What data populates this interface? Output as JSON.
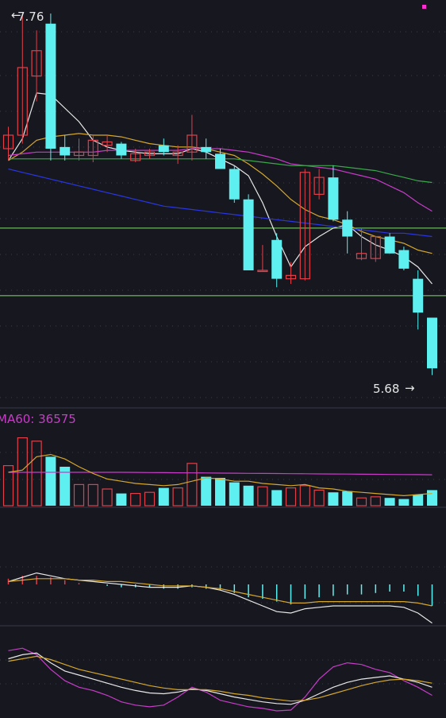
{
  "colors": {
    "background": "#16171f",
    "up": "#e0404a",
    "down": "#5ef0f0",
    "grid": "#3a3d4a",
    "ma_white": "#e8e8e8",
    "ma_yellow": "#d4a72c",
    "ma_magenta": "#c83cc8",
    "ma_green": "#3aa84a",
    "trend_blue": "#2a36e0",
    "hline": "#7fe06a",
    "marker": "#ff2fd0"
  },
  "chart_data": [
    {
      "type": "candlestick",
      "price_range": [
        5.5,
        7.9
      ],
      "high_label": "7.76",
      "low_label": "5.68",
      "high_arrow": "←",
      "low_arrow": "→",
      "candles": [
        {
          "o": 7.02,
          "h": 7.15,
          "l": 6.95,
          "c": 7.1
        },
        {
          "o": 7.1,
          "h": 7.82,
          "l": 7.05,
          "c": 7.5
        },
        {
          "o": 7.45,
          "h": 7.72,
          "l": 7.3,
          "c": 7.6
        },
        {
          "o": 7.76,
          "h": 7.82,
          "l": 6.95,
          "c": 7.02
        },
        {
          "o": 7.03,
          "h": 7.1,
          "l": 6.95,
          "c": 6.98
        },
        {
          "o": 6.98,
          "h": 7.08,
          "l": 6.95,
          "c": 7.0
        },
        {
          "o": 6.98,
          "h": 7.1,
          "l": 6.94,
          "c": 7.07
        },
        {
          "o": 7.04,
          "h": 7.1,
          "l": 7.0,
          "c": 7.06
        },
        {
          "o": 7.05,
          "h": 7.06,
          "l": 6.96,
          "c": 6.98
        },
        {
          "o": 6.95,
          "h": 7.02,
          "l": 6.94,
          "c": 6.99
        },
        {
          "o": 6.98,
          "h": 7.02,
          "l": 6.96,
          "c": 7.0
        },
        {
          "o": 7.04,
          "h": 7.08,
          "l": 6.98,
          "c": 7.0
        },
        {
          "o": 6.98,
          "h": 7.04,
          "l": 6.93,
          "c": 7.0
        },
        {
          "o": 7.0,
          "h": 7.22,
          "l": 6.95,
          "c": 7.1
        },
        {
          "o": 7.03,
          "h": 7.08,
          "l": 6.96,
          "c": 7.0
        },
        {
          "o": 6.99,
          "h": 7.02,
          "l": 6.9,
          "c": 6.9
        },
        {
          "o": 6.9,
          "h": 6.92,
          "l": 6.7,
          "c": 6.72
        },
        {
          "o": 6.72,
          "h": 6.75,
          "l": 6.3,
          "c": 6.3
        },
        {
          "o": 6.3,
          "h": 6.45,
          "l": 6.3,
          "c": 6.3
        },
        {
          "o": 6.48,
          "h": 6.52,
          "l": 6.2,
          "c": 6.25
        },
        {
          "o": 6.25,
          "h": 6.35,
          "l": 6.22,
          "c": 6.27
        },
        {
          "o": 6.25,
          "h": 6.9,
          "l": 6.24,
          "c": 6.88
        },
        {
          "o": 6.75,
          "h": 6.9,
          "l": 6.72,
          "c": 6.85
        },
        {
          "o": 6.85,
          "h": 6.92,
          "l": 6.59,
          "c": 6.6
        },
        {
          "o": 6.6,
          "h": 6.65,
          "l": 6.4,
          "c": 6.5
        },
        {
          "o": 6.37,
          "h": 6.55,
          "l": 6.36,
          "c": 6.4
        },
        {
          "o": 6.37,
          "h": 6.5,
          "l": 6.35,
          "c": 6.5
        },
        {
          "o": 6.5,
          "h": 6.52,
          "l": 6.4,
          "c": 6.4
        },
        {
          "o": 6.42,
          "h": 6.44,
          "l": 6.3,
          "c": 6.31
        },
        {
          "o": 6.25,
          "h": 6.3,
          "l": 5.95,
          "c": 6.05
        },
        {
          "o": 6.02,
          "h": 6.02,
          "l": 5.68,
          "c": 5.72
        }
      ],
      "overlay_lines": [
        {
          "color_key": "ma_white",
          "values": [
            6.95,
            7.08,
            7.35,
            7.34,
            7.26,
            7.18,
            7.07,
            7.03,
            7.01,
            7.0,
            6.99,
            6.99,
            6.99,
            7.02,
            7.0,
            6.96,
            6.92,
            6.86,
            6.7,
            6.5,
            6.32,
            6.44,
            6.5,
            6.55,
            6.57,
            6.5,
            6.45,
            6.42,
            6.38,
            6.32,
            6.22
          ]
        },
        {
          "color_key": "ma_yellow",
          "values": [
            6.95,
            7.0,
            7.07,
            7.09,
            7.1,
            7.11,
            7.1,
            7.1,
            7.09,
            7.07,
            7.05,
            7.04,
            7.03,
            7.03,
            7.02,
            7.0,
            6.98,
            6.93,
            6.87,
            6.8,
            6.72,
            6.66,
            6.62,
            6.6,
            6.57,
            6.53,
            6.5,
            6.48,
            6.46,
            6.42,
            6.4
          ]
        },
        {
          "color_key": "ma_magenta",
          "values": [
            6.98,
            6.99,
            7.0,
            7.0,
            7.0,
            7.0,
            7.0,
            7.01,
            7.01,
            7.01,
            7.01,
            7.01,
            7.01,
            7.02,
            7.02,
            7.02,
            7.01,
            7.0,
            6.98,
            6.96,
            6.93,
            6.92,
            6.91,
            6.9,
            6.88,
            6.86,
            6.84,
            6.8,
            6.76,
            6.7,
            6.65
          ]
        },
        {
          "color_key": "ma_green",
          "values": [
            6.96,
            6.96,
            6.96,
            6.96,
            6.96,
            6.96,
            6.96,
            6.96,
            6.96,
            6.96,
            6.96,
            6.96,
            6.96,
            6.96,
            6.96,
            6.96,
            6.96,
            6.95,
            6.94,
            6.93,
            6.92,
            6.92,
            6.92,
            6.92,
            6.91,
            6.9,
            6.89,
            6.87,
            6.85,
            6.83,
            6.82
          ]
        },
        {
          "color_key": "trend_blue",
          "values": [
            6.9,
            6.88,
            6.86,
            6.84,
            6.82,
            6.8,
            6.78,
            6.76,
            6.74,
            6.72,
            6.7,
            6.68,
            6.67,
            6.66,
            6.65,
            6.64,
            6.63,
            6.62,
            6.61,
            6.6,
            6.59,
            6.58,
            6.57,
            6.56,
            6.55,
            6.54,
            6.53,
            6.52,
            6.52,
            6.51,
            6.5
          ]
        }
      ],
      "horizontal_lines": [
        6.55,
        6.15
      ]
    },
    {
      "type": "bar",
      "indicator_label": "MA60: 36575",
      "volumes": [
        36000,
        61000,
        58000,
        44000,
        35000,
        19000,
        19000,
        15000,
        11000,
        11000,
        12000,
        16000,
        16000,
        38000,
        26000,
        25000,
        21000,
        18000,
        17000,
        14000,
        16000,
        18000,
        14000,
        12000,
        13000,
        7000,
        8000,
        7000,
        6000,
        10000,
        14000
      ],
      "ma60_value": 36575,
      "ma_lines": [
        {
          "color_key": "ma_magenta",
          "values": [
            30000,
            30000,
            30000,
            30000,
            30000,
            30000,
            30000,
            30000,
            30000,
            29900,
            29800,
            29700,
            29600,
            29500,
            29400,
            29300,
            29200,
            29100,
            29000,
            28900,
            28800,
            28700,
            28600,
            28500,
            28400,
            28300,
            28200,
            28100,
            28000,
            27900,
            27800
          ]
        },
        {
          "color_key": "ma_yellow",
          "values": [
            30000,
            32000,
            44000,
            46000,
            42000,
            35000,
            29000,
            24000,
            22000,
            20000,
            19000,
            18000,
            19000,
            22000,
            25000,
            24000,
            22000,
            22000,
            20000,
            19000,
            18000,
            19000,
            16000,
            15000,
            13000,
            12000,
            11000,
            10000,
            9000,
            10000,
            11000
          ]
        }
      ]
    },
    {
      "type": "bar",
      "macd_hist": [
        0.04,
        0.06,
        0.06,
        0.05,
        0.03,
        0.01,
        0,
        -0.01,
        -0.02,
        -0.02,
        -0.02,
        -0.03,
        -0.03,
        -0.02,
        -0.03,
        -0.04,
        -0.06,
        -0.09,
        -0.1,
        -0.12,
        -0.14,
        -0.1,
        -0.09,
        -0.08,
        -0.07,
        -0.07,
        -0.06,
        -0.05,
        -0.05,
        -0.08,
        -0.15
      ],
      "dif": [
        0.02,
        0.05,
        0.08,
        0.06,
        0.04,
        0.03,
        0.02,
        0.01,
        0,
        -0.01,
        -0.02,
        -0.02,
        -0.02,
        -0.01,
        -0.02,
        -0.04,
        -0.07,
        -0.11,
        -0.15,
        -0.19,
        -0.2,
        -0.17,
        -0.16,
        -0.15,
        -0.15,
        -0.15,
        -0.15,
        -0.15,
        -0.16,
        -0.2,
        -0.27
      ],
      "dea": [
        0.02,
        0.03,
        0.04,
        0.04,
        0.04,
        0.03,
        0.03,
        0.02,
        0.02,
        0.01,
        0,
        -0.01,
        -0.01,
        -0.01,
        -0.02,
        -0.03,
        -0.05,
        -0.07,
        -0.09,
        -0.11,
        -0.13,
        -0.13,
        -0.12,
        -0.12,
        -0.12,
        -0.12,
        -0.12,
        -0.12,
        -0.12,
        -0.13,
        -0.15
      ]
    },
    {
      "type": "line",
      "kdj_k": [
        65,
        70,
        72,
        60,
        50,
        45,
        40,
        35,
        30,
        26,
        23,
        22,
        24,
        28,
        26,
        22,
        18,
        15,
        12,
        10,
        9,
        14,
        22,
        30,
        36,
        40,
        42,
        44,
        40,
        36,
        30
      ],
      "kdj_d": [
        62,
        65,
        68,
        64,
        58,
        52,
        48,
        44,
        40,
        36,
        32,
        29,
        27,
        27,
        27,
        25,
        22,
        20,
        17,
        15,
        13,
        14,
        17,
        22,
        27,
        32,
        36,
        39,
        40,
        38,
        35
      ],
      "kdj_j": [
        75,
        78,
        70,
        52,
        38,
        30,
        26,
        20,
        12,
        8,
        6,
        8,
        18,
        30,
        24,
        14,
        10,
        6,
        4,
        1,
        2,
        18,
        40,
        55,
        60,
        58,
        52,
        48,
        38,
        30,
        20
      ]
    }
  ]
}
